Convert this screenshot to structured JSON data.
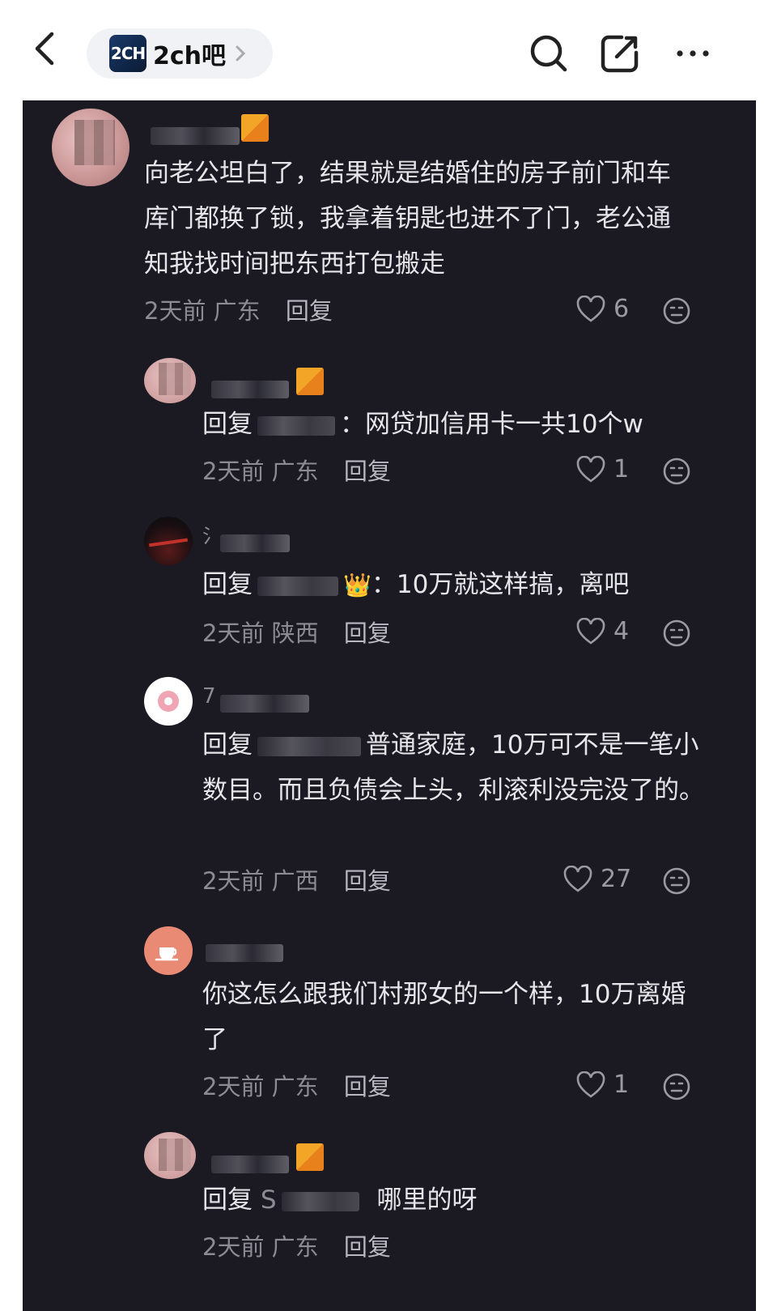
{
  "header": {
    "forum_logo_text": "2CH",
    "forum_name": "2ch吧",
    "icons": [
      "back-arrow-icon",
      "search-icon",
      "share-icon",
      "more-icon"
    ]
  },
  "comments": [
    {
      "text": "向老公坦白了，结果就是结婚住的房子前门和车库门都换了锁，我拿着钥匙也进不了门，老公通知我找时间把东西打包搬走",
      "time": "2天前",
      "location": "广东",
      "reply_label": "回复",
      "likes": "6"
    },
    {
      "reply_prefix": "回复",
      "text": "：网贷加信用卡一共10个w",
      "time": "2天前",
      "location": "广东",
      "reply_label": "回复",
      "likes": "1"
    },
    {
      "name_initial": "氵",
      "reply_prefix": "回复",
      "crown": "👑",
      "text": "：10万就这样搞，离吧",
      "time": "2天前",
      "location": "陕西",
      "reply_label": "回复",
      "likes": "4"
    },
    {
      "name_initial": "7",
      "reply_prefix": "回复",
      "text": "普通家庭，10万可不是一笔小数目。而且负债会上头，利滚利没完没了的。",
      "time": "2天前",
      "location": "广西",
      "reply_label": "回复",
      "likes": "27"
    },
    {
      "text": "你这怎么跟我们村那女的一个样，10万离婚了",
      "time": "2天前",
      "location": "广东",
      "reply_label": "回复",
      "likes": "1"
    },
    {
      "reply_prefix": "回复",
      "target_initial": "S",
      "text": "哪里的呀",
      "time": "2天前",
      "location": "广东",
      "reply_label": "回复"
    }
  ]
}
